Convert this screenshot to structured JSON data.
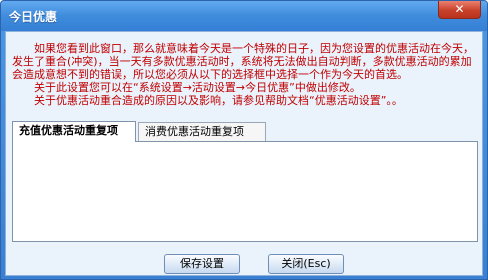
{
  "window": {
    "title": "今日优惠",
    "close_label": "✕"
  },
  "notice": {
    "line1": "如果您看到此窗口，那么就意味着今天是一个特殊的日子，因为您设置的优惠活动在今天，发生了重合(冲突)，当一天有多款优惠活动时，系统将无法做出自动判断，多款优惠活动的累加会造成意想不到的错误，所以您必须从以下的选择框中选择一个作为今天的首选。",
    "line2": "关于此设置您可以在“系统设置→活动设置→今日优惠”中做出修改。",
    "line3": "关于优惠活动重合造成的原因以及影响，请参见帮助文档“优惠活动设置”。。",
    "color": "#c00000"
  },
  "tabs": [
    {
      "label": "充值优惠活动重复项",
      "active": true
    },
    {
      "label": "消费优惠活动重复项",
      "active": false
    }
  ],
  "buttons": {
    "save": "保存设置",
    "close": "关闭(Esc)"
  }
}
